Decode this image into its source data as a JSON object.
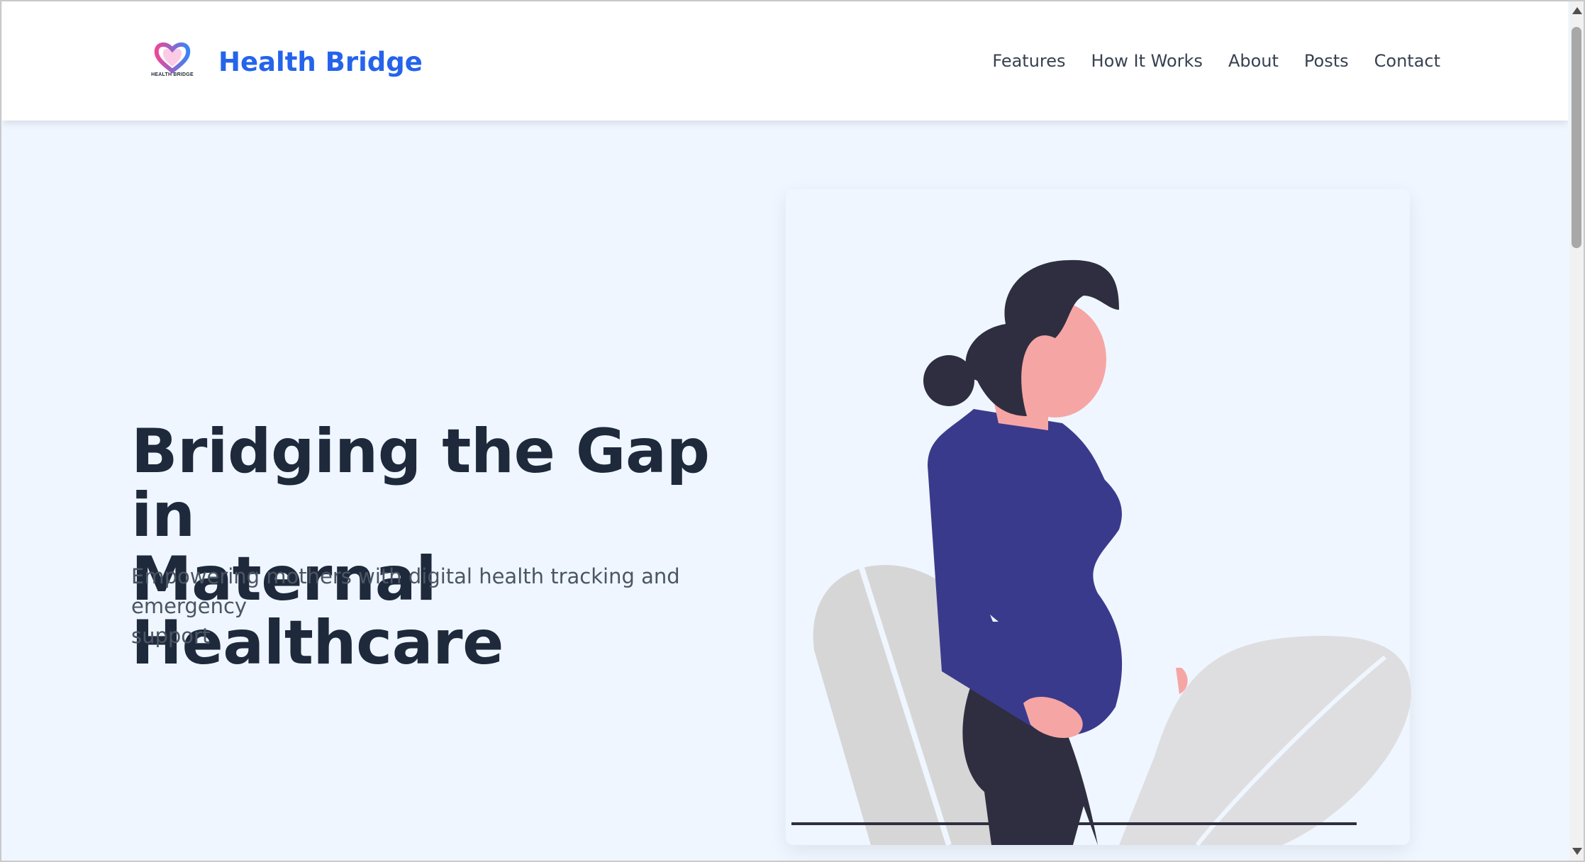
{
  "brand": {
    "logo_text": "HEALTH BRIDGE",
    "name": "Health Bridge",
    "logo_colors": [
      "#ec4899",
      "#3b82f6"
    ]
  },
  "nav": {
    "links": [
      "Features",
      "How It Works",
      "About",
      "Posts",
      "Contact"
    ]
  },
  "hero": {
    "title_line1": "Bridging the Gap in",
    "title_line2": "Maternal Healthcare",
    "subtitle_line1": "Empowering mothers with digital health tracking and emergency",
    "subtitle_line2": "support"
  },
  "illustration": {
    "icon": "pregnant-woman-illustration",
    "colors": {
      "hair": "#2f2e41",
      "skin": "#f6a5a5",
      "shirt": "#3a3a8c",
      "pants": "#2f2e41",
      "chair": "#d6d6d6",
      "chair_light": "#dedee0"
    }
  },
  "theme": {
    "background": "#eff6ff",
    "accent": "#2563eb",
    "heading": "#1e293b"
  }
}
